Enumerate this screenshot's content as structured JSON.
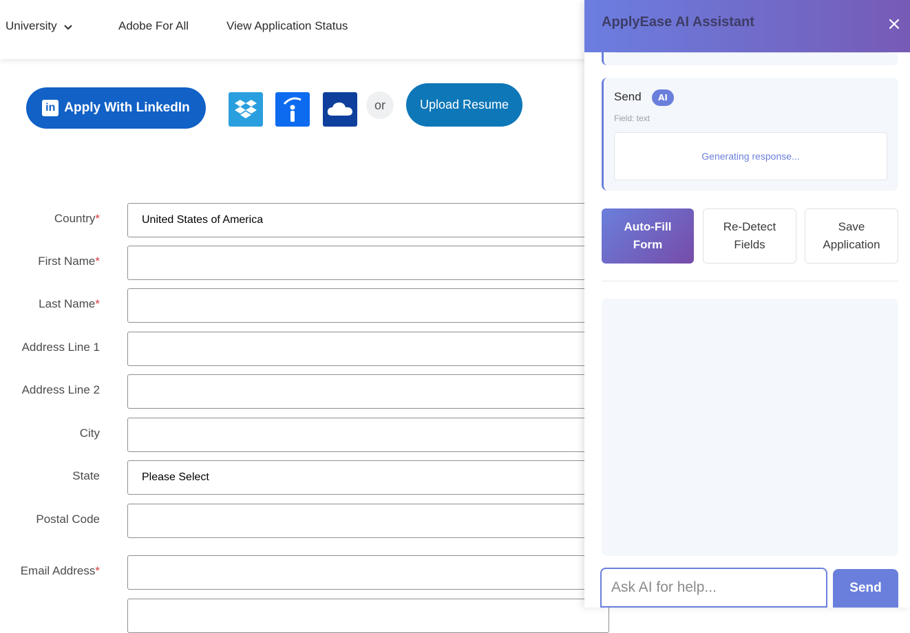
{
  "nav": {
    "university": "University",
    "adobe_for_all": "Adobe For All",
    "view_status": "View Application Status"
  },
  "apply": {
    "linkedin_label": "Apply With LinkedIn",
    "linkedin_logo": "in",
    "or_label": "or",
    "upload_label": "Upload Resume",
    "icons": [
      "dropbox-icon",
      "indeed-icon",
      "onedrive-icon"
    ]
  },
  "form": {
    "required_mark": "*",
    "fields": [
      {
        "label": "Country",
        "value": "United States of America"
      },
      {
        "label": "First Name",
        "value": ""
      },
      {
        "label": "Last Name",
        "value": ""
      },
      {
        "label": "Address Line 1",
        "value": ""
      },
      {
        "label": "Address Line 2",
        "value": ""
      },
      {
        "label": "City",
        "value": ""
      },
      {
        "label": "State",
        "value": "Please Select"
      },
      {
        "label": "Postal Code",
        "value": ""
      },
      {
        "label": "Email Address",
        "value": ""
      }
    ]
  },
  "panel": {
    "title": "ApplyEase AI Assistant",
    "close_icon": "×",
    "field_card": {
      "name": "Send",
      "badge": "AI",
      "type": "Field: text",
      "response": "Generating response..."
    },
    "buttons": {
      "autofill_line1": "Auto-Fill",
      "autofill_line2": "Form",
      "redetect_line1": "Re-Detect",
      "redetect_line2": "Fields",
      "save_line1": "Save",
      "save_line2": "Application"
    },
    "chat": {
      "placeholder": "Ask AI for help...",
      "send_label": "Send"
    }
  },
  "colors": {
    "accent": "#6a7fdc",
    "linkedin": "#1161c6",
    "upload": "#0e77b8",
    "required": "#d7373f"
  }
}
